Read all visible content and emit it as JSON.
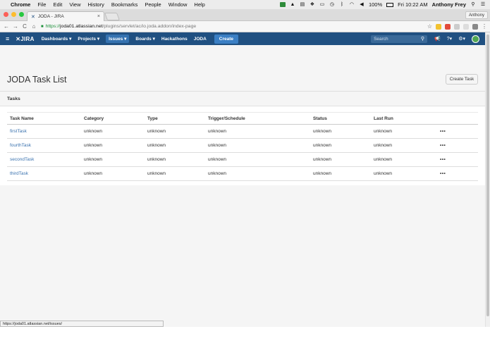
{
  "mac_menubar": {
    "apple": "",
    "app": "Chrome",
    "menus": [
      "File",
      "Edit",
      "View",
      "History",
      "Bookmarks",
      "People",
      "Window",
      "Help"
    ],
    "battery": "100%",
    "clock": "Fri 10:22 AM",
    "user": "Anthony Frey"
  },
  "browser": {
    "tab_title": "JODA - JIRA",
    "tab_close": "×",
    "profile": "Anthony",
    "url_scheme": "https://",
    "url_host": "joda01.atlassian.net",
    "url_path": "/plugins/servlet/ac/io.joda.addon/index-page",
    "status_url": "https://joda01.atlassian.net/issues/"
  },
  "jira_header": {
    "logo": "JIRA",
    "nav": [
      "Dashboards ▾",
      "Projects ▾",
      "Issues ▾",
      "Boards ▾",
      "Hackathons",
      "JODA"
    ],
    "active_nav": "Issues ▾",
    "create_label": "Create",
    "search_placeholder": "Search"
  },
  "page": {
    "title": "JODA Task List",
    "create_task_label": "Create Task",
    "section_title": "Tasks"
  },
  "table": {
    "columns": [
      "Task Name",
      "Category",
      "Type",
      "Trigger/Schedule",
      "Status",
      "Last Run"
    ],
    "rows": [
      {
        "name": "firstTask",
        "category": "unknown",
        "type": "unknown",
        "trigger": "unknown",
        "status": "unknown",
        "last_run": "unknown",
        "actions": "•••"
      },
      {
        "name": "fourthTask",
        "category": "unknown",
        "type": "unknown",
        "trigger": "unknown",
        "status": "unknown",
        "last_run": "unknown",
        "actions": "•••"
      },
      {
        "name": "secondTask",
        "category": "unknown",
        "type": "unknown",
        "trigger": "unknown",
        "status": "unknown",
        "last_run": "unknown",
        "actions": "•••"
      },
      {
        "name": "thirdTask",
        "category": "unknown",
        "type": "unknown",
        "trigger": "unknown",
        "status": "unknown",
        "last_run": "unknown",
        "actions": "•••"
      }
    ]
  },
  "colors": {
    "jira_header": "#205081",
    "link": "#3b73af",
    "create_button": "#3b7fc4"
  }
}
